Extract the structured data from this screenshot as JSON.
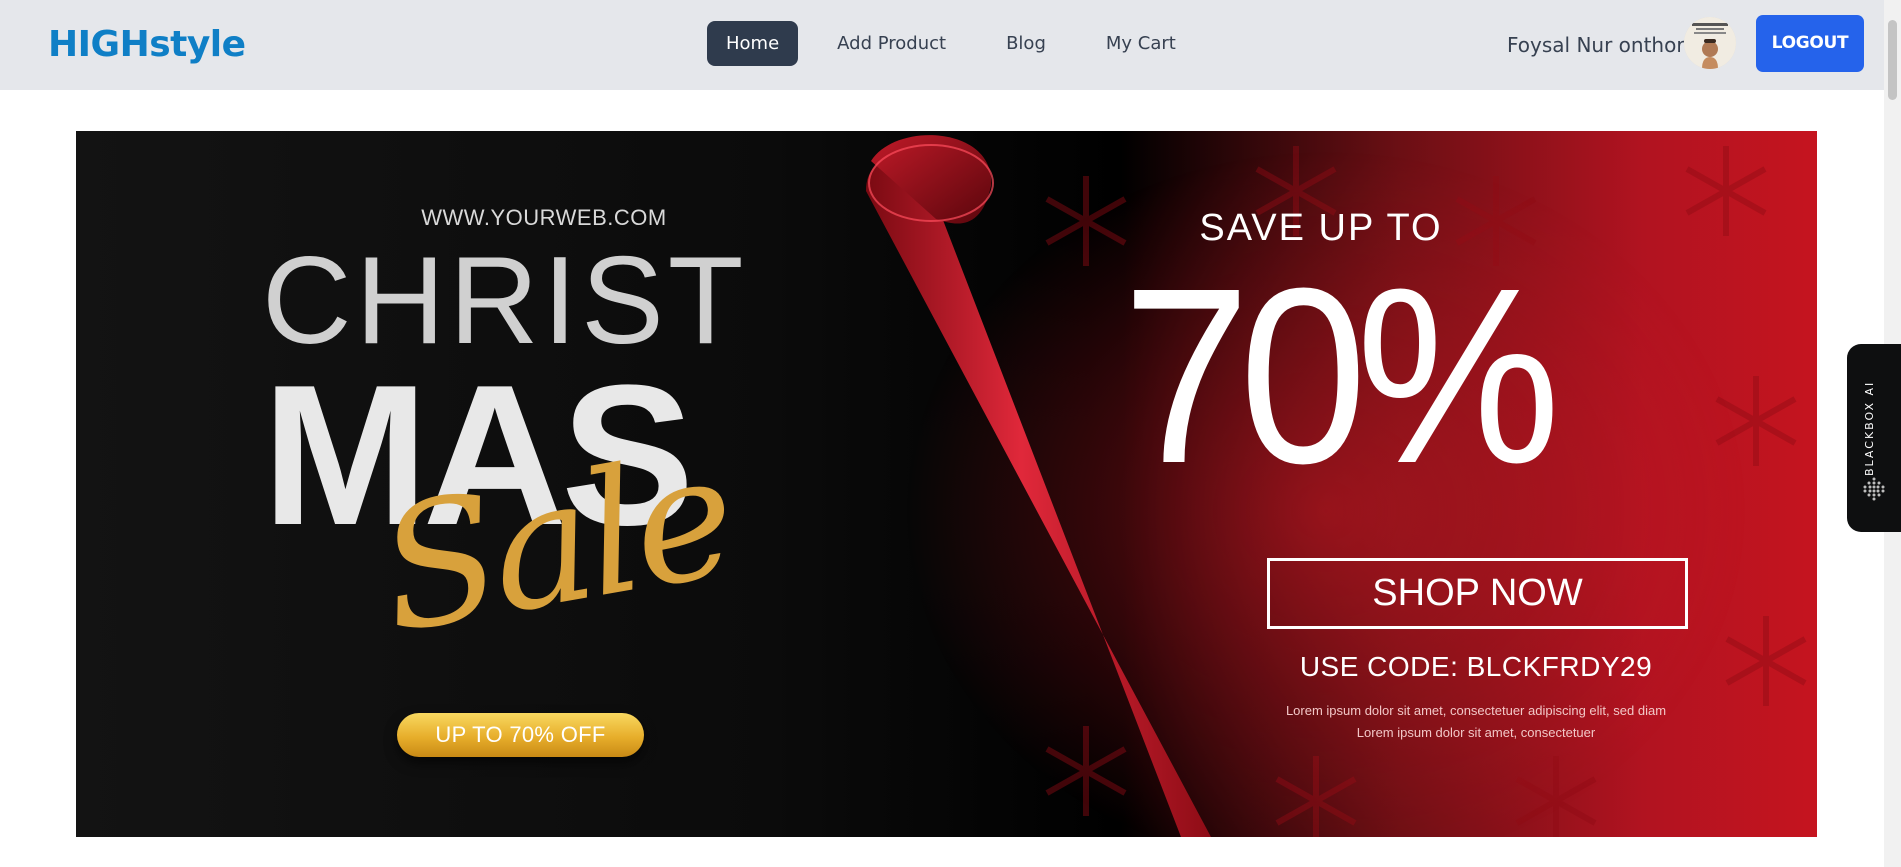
{
  "header": {
    "brand": "HIGHstyle",
    "nav": [
      "Home",
      "Add Product",
      "Blog",
      "My Cart"
    ],
    "active_nav": "Home",
    "user_name": "Foysal Nur onthor",
    "logout_label": "LOGOUT"
  },
  "banner": {
    "url_text": "WWW.YOURWEB.COM",
    "title_line1": "CHRIST",
    "title_line2": "MAS",
    "title_script": "Sale",
    "pill_text": "UP TO 70% OFF",
    "save_text": "SAVE UP TO",
    "percent_text": "70%",
    "shop_now": "SHOP NOW",
    "code_text": "USE CODE: BLCKFRDY29",
    "lorem_line1": "Lorem ipsum dolor sit amet, consectetuer adipiscing elit, sed diam",
    "lorem_line2": "Lorem ipsum dolor sit amet, consectetuer"
  },
  "sidebar_widget": {
    "label": "BLACKBOX AI"
  },
  "colors": {
    "brand": "#0f7fc6",
    "nav_active_bg": "#2f3b4d",
    "logout_bg": "#2563eb",
    "banner_red": "#c5141f"
  }
}
